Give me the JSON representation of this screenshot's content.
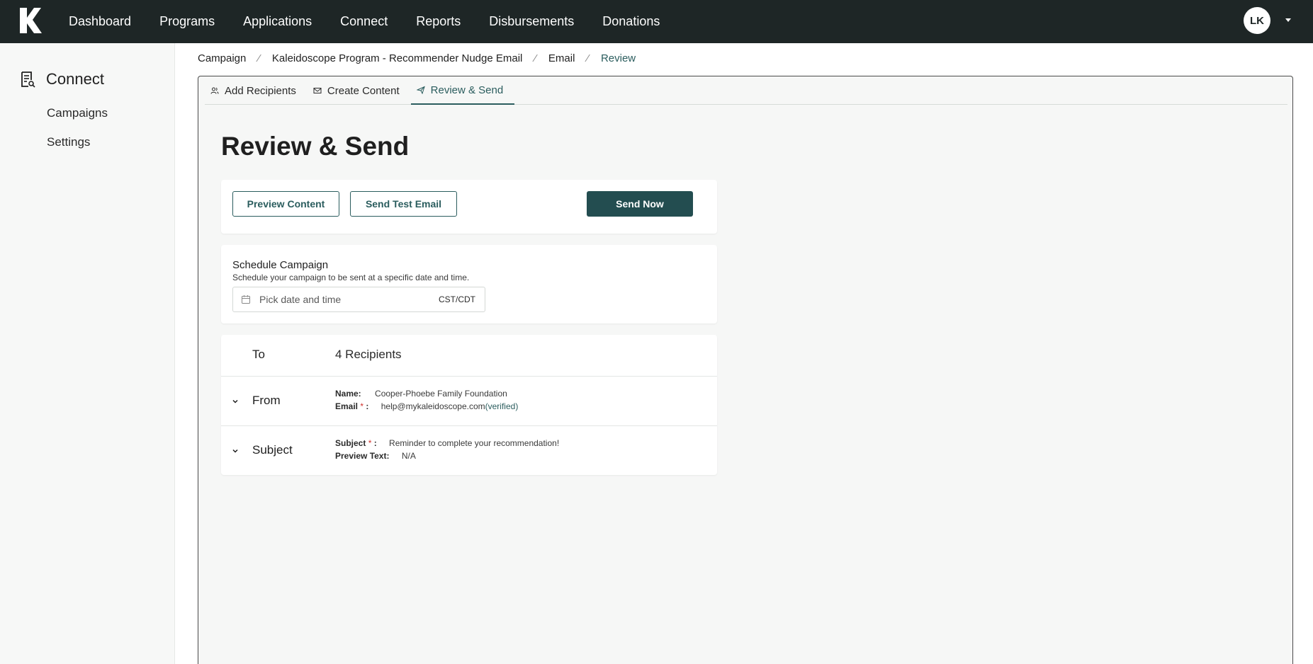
{
  "nav": {
    "logo": "K",
    "items": [
      "Dashboard",
      "Programs",
      "Applications",
      "Connect",
      "Reports",
      "Disbursements",
      "Donations"
    ],
    "avatar_initials": "LK"
  },
  "sidebar": {
    "title": "Connect",
    "items": [
      "Campaigns",
      "Settings"
    ]
  },
  "breadcrumb": {
    "items": [
      "Campaign",
      "Kaleidoscope Program - Recommender Nudge Email",
      "Email",
      "Review"
    ],
    "separator": "⁄"
  },
  "tabs": [
    "Add Recipients",
    "Create Content",
    "Review & Send"
  ],
  "page_title": "Review & Send",
  "actions": {
    "preview": "Preview Content",
    "test": "Send Test Email",
    "send": "Send Now"
  },
  "schedule": {
    "title": "Schedule Campaign",
    "subtitle": "Schedule your campaign to be sent at a specific date and time.",
    "placeholder": "Pick date and time",
    "timezone": "CST/CDT"
  },
  "summary": {
    "to_label": "To",
    "to_value": "4 Recipients",
    "from_label": "From",
    "name_key": "Name:",
    "name_value": "Cooper-Phoebe Family Foundation",
    "email_key": "Email",
    "required_mark": "*",
    "colon": ":",
    "email_value": "help@mykaleidoscope.com",
    "email_status": "(verified)",
    "subject_label": "Subject",
    "subject_key": "Subject",
    "subject_value": "Reminder to complete your recommendation!",
    "preview_key": "Preview Text:",
    "preview_value": "N/A"
  },
  "colors": {
    "topbar": "#1e2626",
    "accent": "#2b5d5e",
    "primary_button": "#234d50",
    "required": "#d0302a"
  }
}
